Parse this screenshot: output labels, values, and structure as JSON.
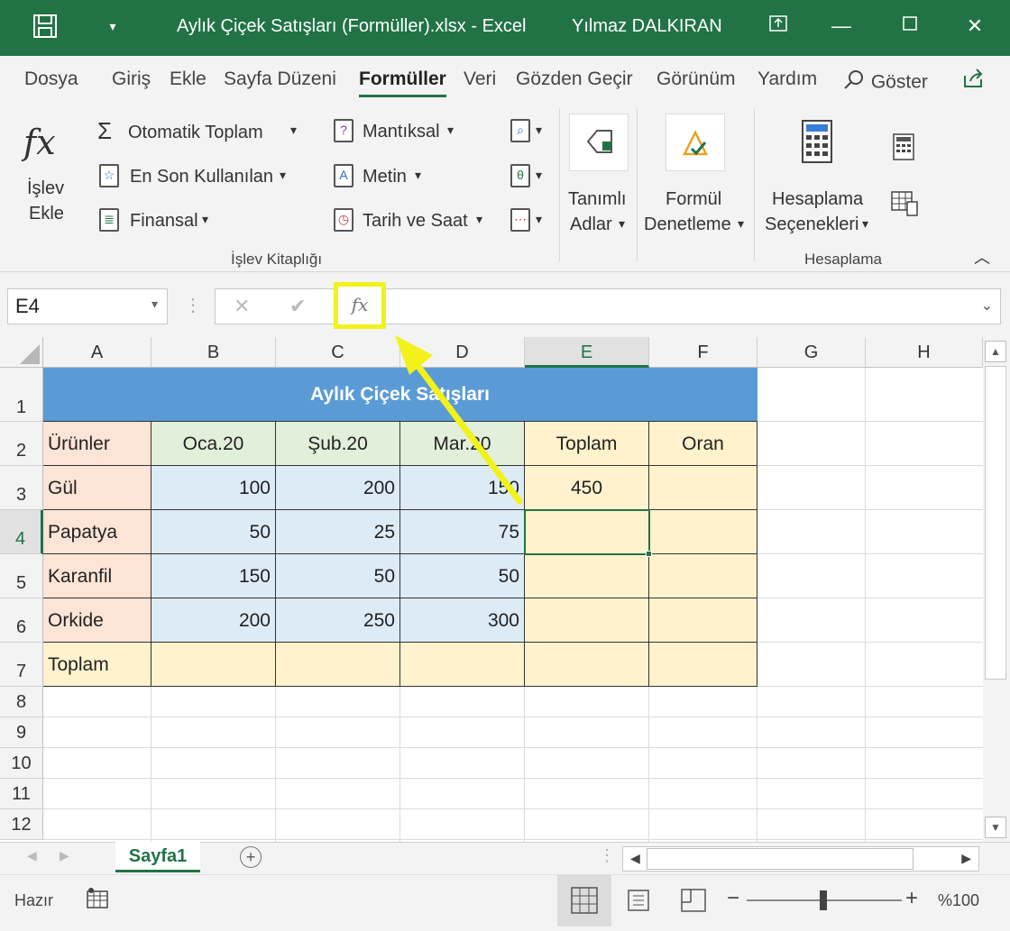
{
  "window": {
    "title": "Aylık Çiçek Satışları (Formüller).xlsx  -  Excel",
    "user": "Yılmaz DALKIRAN"
  },
  "tabs": [
    "Dosya",
    "Giriş",
    "Ekle",
    "Sayfa Düzeni",
    "Formüller",
    "Veri",
    "Gözden Geçir",
    "Görünüm",
    "Yardım"
  ],
  "tell_me": "Göster",
  "ribbon": {
    "insert_function": {
      "line1": "İşlev",
      "line2": "Ekle"
    },
    "autosum": "Otomatik Toplam",
    "recently_used": "En Son Kullanılan",
    "financial": "Finansal",
    "logical": "Mantıksal",
    "text": "Metin",
    "date_time": "Tarih ve Saat",
    "defined_names": {
      "line1": "Tanımlı",
      "line2": "Adlar"
    },
    "formula_auditing": {
      "line1": "Formül",
      "line2": "Denetleme"
    },
    "calc_options": {
      "line1": "Hesaplama",
      "line2": "Seçenekleri"
    },
    "group_function_library": "İşlev Kitaplığı",
    "group_calculation": "Hesaplama"
  },
  "formula_bar": {
    "name_box": "E4",
    "fx_label": "fx",
    "formula": ""
  },
  "columns": [
    "A",
    "B",
    "C",
    "D",
    "E",
    "F",
    "G",
    "H"
  ],
  "selected_column": "E",
  "selected_row": "4",
  "rows": [
    "1",
    "2",
    "3",
    "4",
    "5",
    "6",
    "7",
    "8",
    "9",
    "10",
    "11",
    "12"
  ],
  "sheet": {
    "title": "Aylık Çiçek Satışları",
    "headers": [
      "Ürünler",
      "Oca.20",
      "Şub.20",
      "Mar.20",
      "Toplam",
      "Oran"
    ],
    "data_rows": [
      {
        "product": "Gül",
        "jan": "100",
        "feb": "200",
        "mar": "150",
        "total": "450",
        "ratio": ""
      },
      {
        "product": "Papatya",
        "jan": "50",
        "feb": "25",
        "mar": "75",
        "total": "",
        "ratio": ""
      },
      {
        "product": "Karanfil",
        "jan": "150",
        "feb": "50",
        "mar": "50",
        "total": "",
        "ratio": ""
      },
      {
        "product": "Orkide",
        "jan": "200",
        "feb": "250",
        "mar": "300",
        "total": "",
        "ratio": ""
      }
    ],
    "total_label": "Toplam"
  },
  "sheet_tab": "Sayfa1",
  "status": {
    "ready": "Hazır",
    "zoom": "%100"
  },
  "colors": {
    "accent": "#217346",
    "title_fill": "#5b9bd5",
    "header_green": "#e2efda",
    "label_pink": "#fce4d6",
    "data_blue": "#ddebf7",
    "total_yellow": "#fff2cc",
    "highlight": "#f2f21a"
  }
}
